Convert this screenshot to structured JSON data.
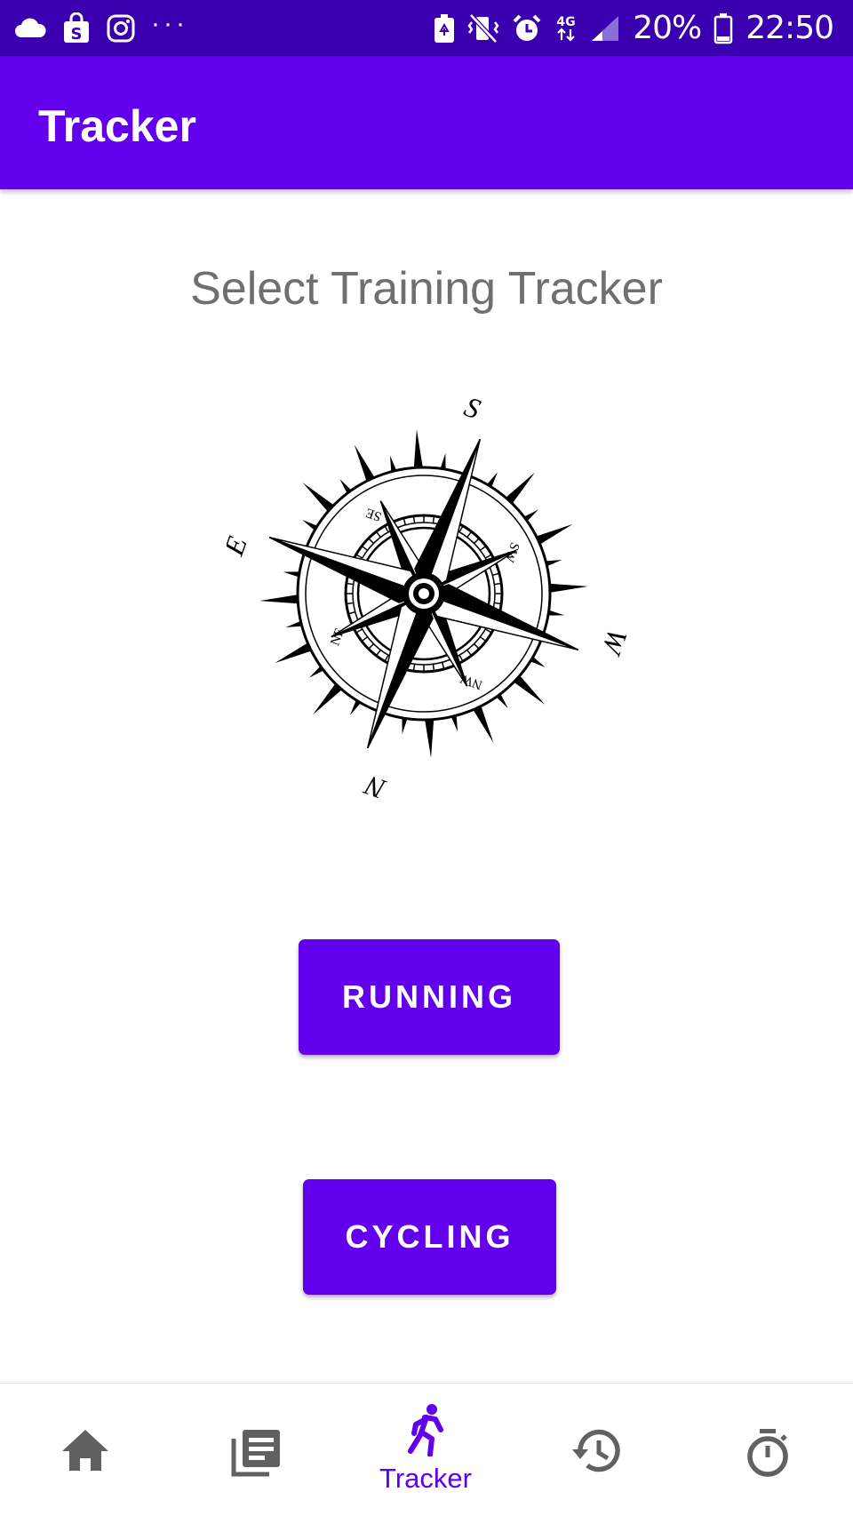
{
  "status_bar": {
    "battery_percent": "20%",
    "time": "22:50",
    "network": "4G",
    "left_icons": [
      "cloud-icon",
      "shop-icon",
      "instagram-icon",
      "more-dots-icon"
    ],
    "right_icons": [
      "battery-saver-icon",
      "vibrate-icon",
      "alarm-icon",
      "network-4g-icon",
      "signal-icon",
      "battery-icon"
    ]
  },
  "app_bar": {
    "title": "Tracker"
  },
  "main": {
    "headline": "Select Training Tracker",
    "compass": {
      "n": "N",
      "s": "S",
      "e": "E",
      "w": "W",
      "ne": "NE",
      "nw": "NW",
      "se": "SE",
      "sw": "SW"
    },
    "running_label": "RUNNING",
    "cycling_label": "CYCLING"
  },
  "bottom_nav": {
    "items": [
      {
        "icon": "home-icon",
        "label": ""
      },
      {
        "icon": "articles-icon",
        "label": ""
      },
      {
        "icon": "run-icon",
        "label": "Tracker",
        "active": true
      },
      {
        "icon": "history-icon",
        "label": ""
      },
      {
        "icon": "timer-icon",
        "label": ""
      }
    ]
  },
  "colors": {
    "primary": "#6200ee",
    "status_bar": "#3a00b0",
    "inactive_icon": "#616161",
    "headline": "#6f6f6f"
  }
}
